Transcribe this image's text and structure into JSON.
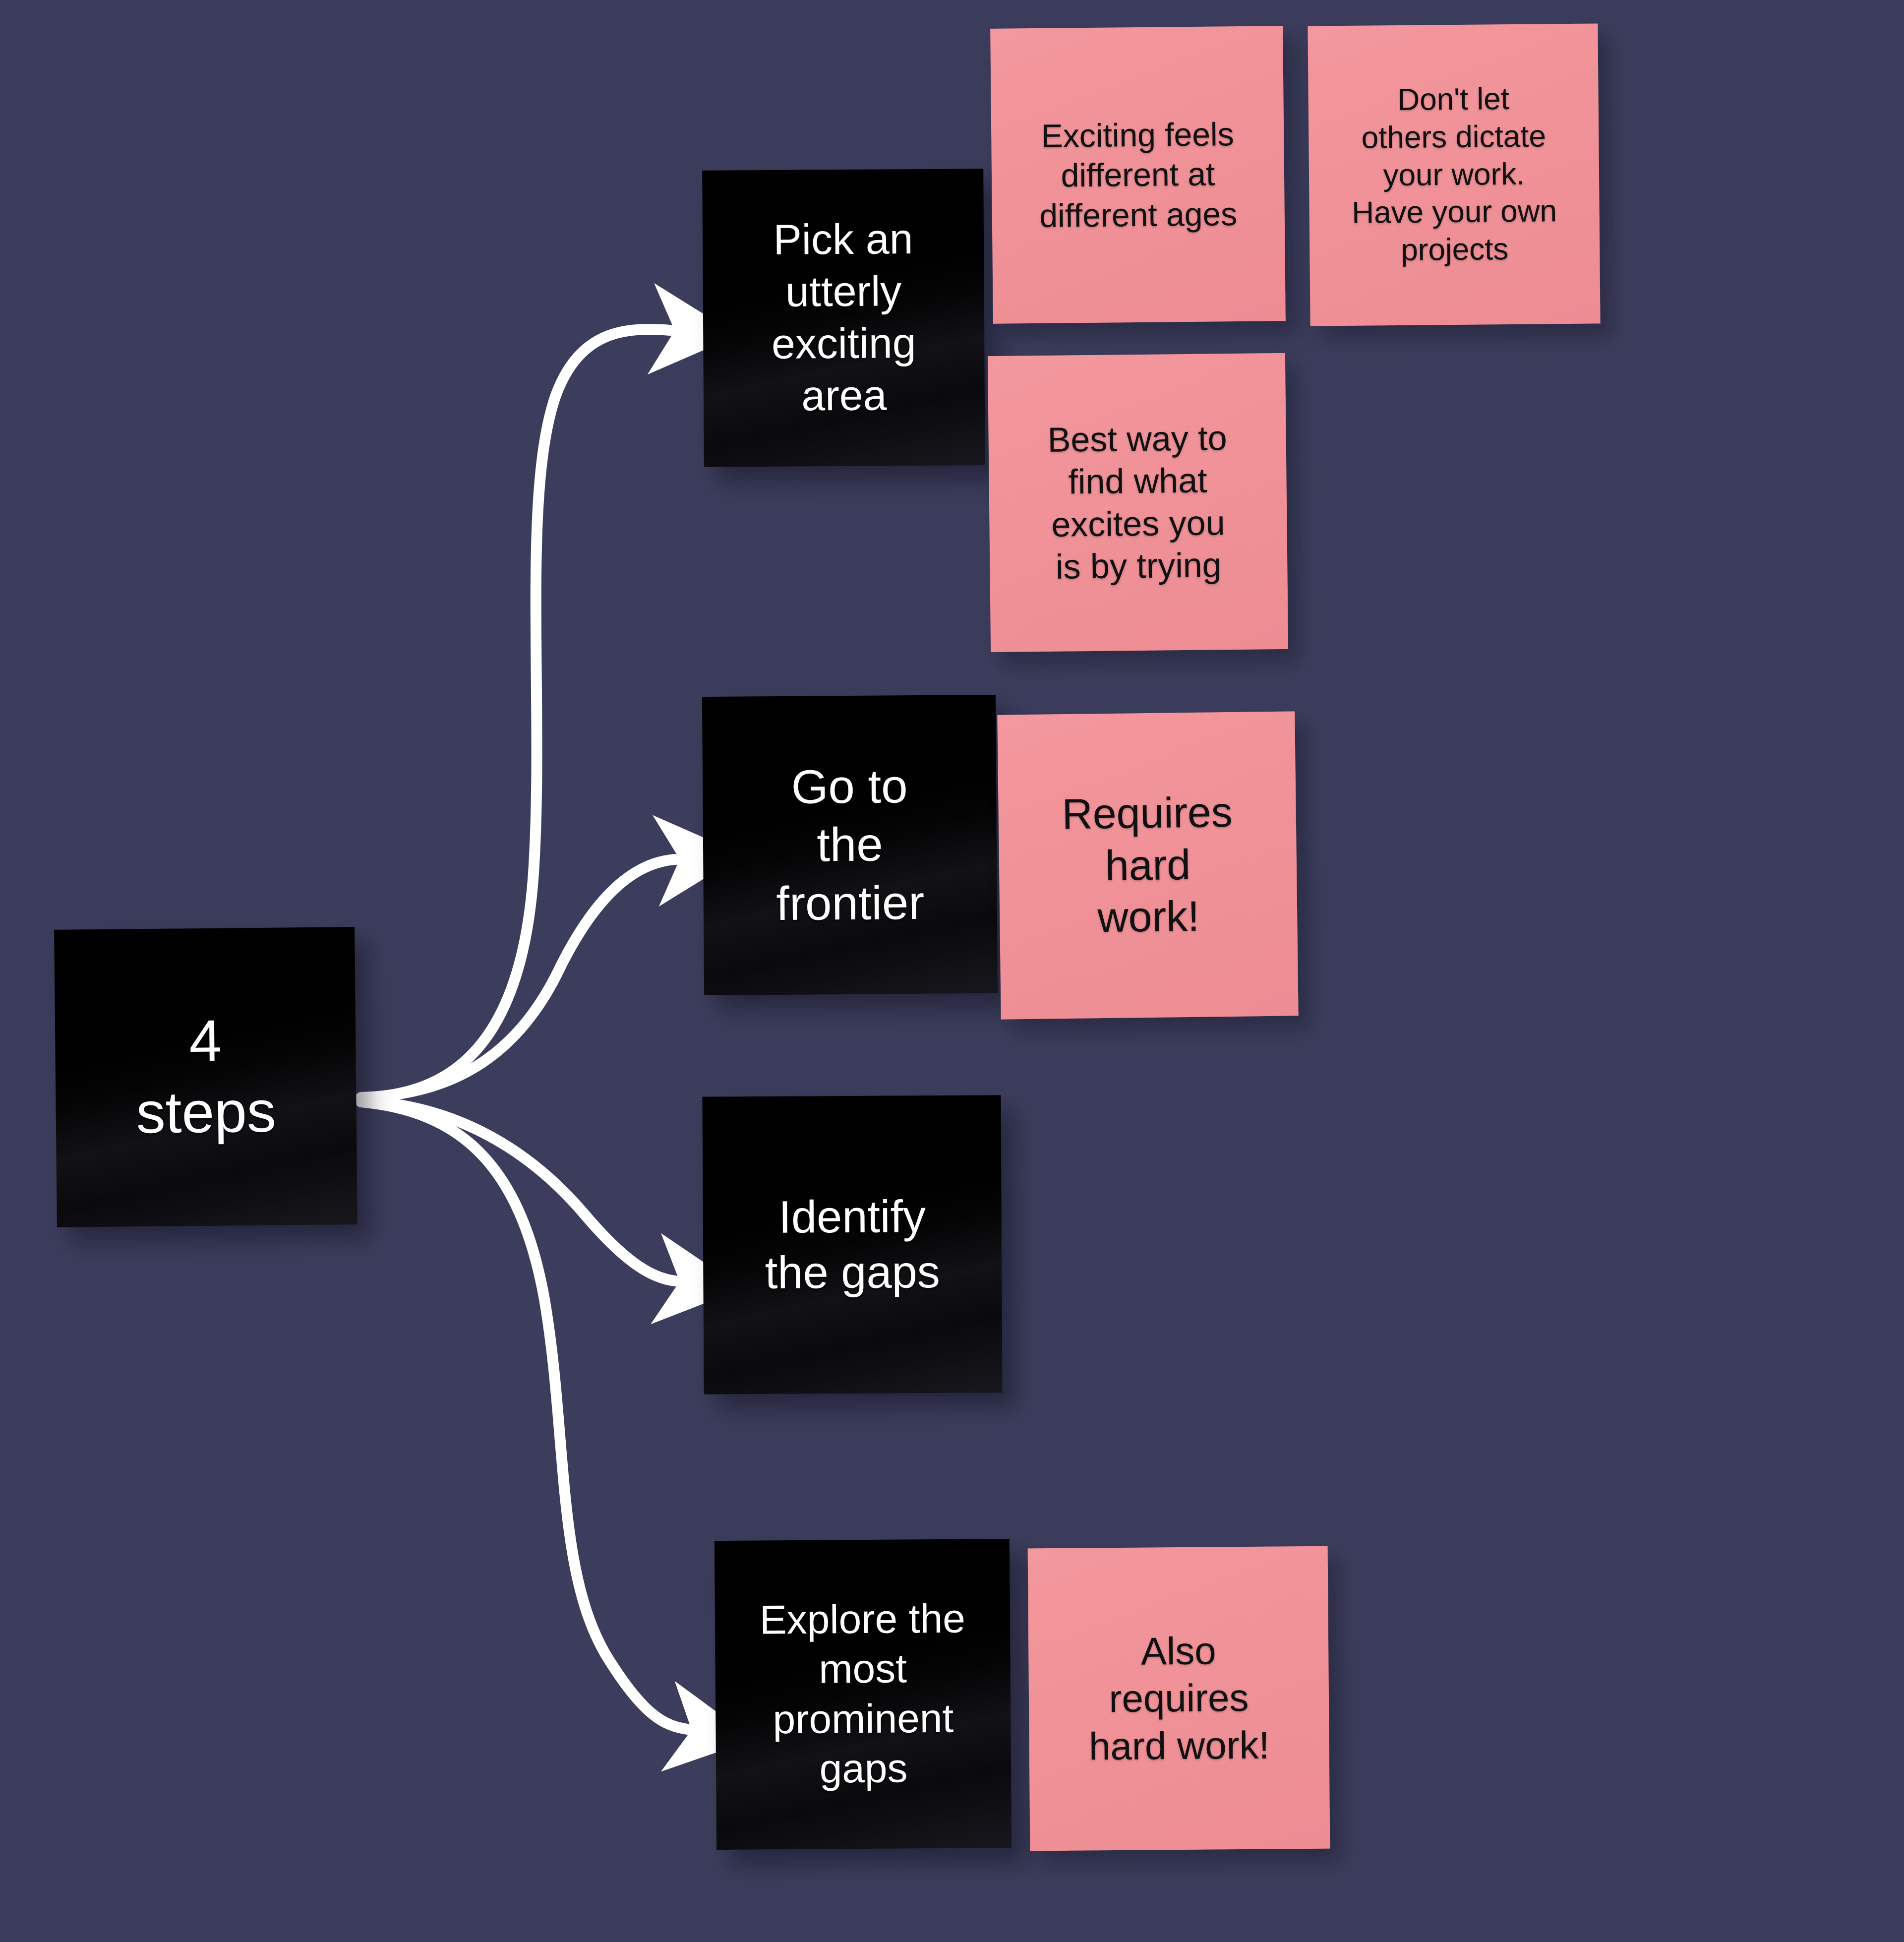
{
  "board": {
    "background_color": "#3c3d5c",
    "note_color": "#f09298",
    "card_color": "#000000",
    "arrow_color": "#ffffff"
  },
  "root": {
    "label": "4\nsteps"
  },
  "steps": [
    {
      "id": "step-1",
      "label": "Pick an\nutterly\nexciting\narea",
      "notes": [
        {
          "id": "note-ages",
          "text": "Exciting feels\ndifferent at\ndifferent ages"
        },
        {
          "id": "note-dictate",
          "text": "Don't let\nothers dictate\nyour work.\nHave your own\nprojects"
        },
        {
          "id": "note-trying",
          "text": "Best way to\nfind what\nexcites you\nis  by trying"
        }
      ]
    },
    {
      "id": "step-2",
      "label": "Go to\nthe\nfrontier",
      "notes": [
        {
          "id": "note-hardwork",
          "text": "Requires\nhard\nwork!"
        }
      ]
    },
    {
      "id": "step-3",
      "label": "Identify\nthe gaps",
      "notes": []
    },
    {
      "id": "step-4",
      "label": "Explore the\nmost\nprominent\ngaps",
      "notes": [
        {
          "id": "note-also-hardwork",
          "text": "Also\nrequires\nhard work!"
        }
      ]
    }
  ],
  "connectors": [
    {
      "id": "arrow-to-step-1",
      "from": "root",
      "to": "step-1"
    },
    {
      "id": "arrow-to-step-2",
      "from": "root",
      "to": "step-2"
    },
    {
      "id": "arrow-to-step-3",
      "from": "root",
      "to": "step-3"
    },
    {
      "id": "arrow-to-step-4",
      "from": "root",
      "to": "step-4"
    }
  ]
}
